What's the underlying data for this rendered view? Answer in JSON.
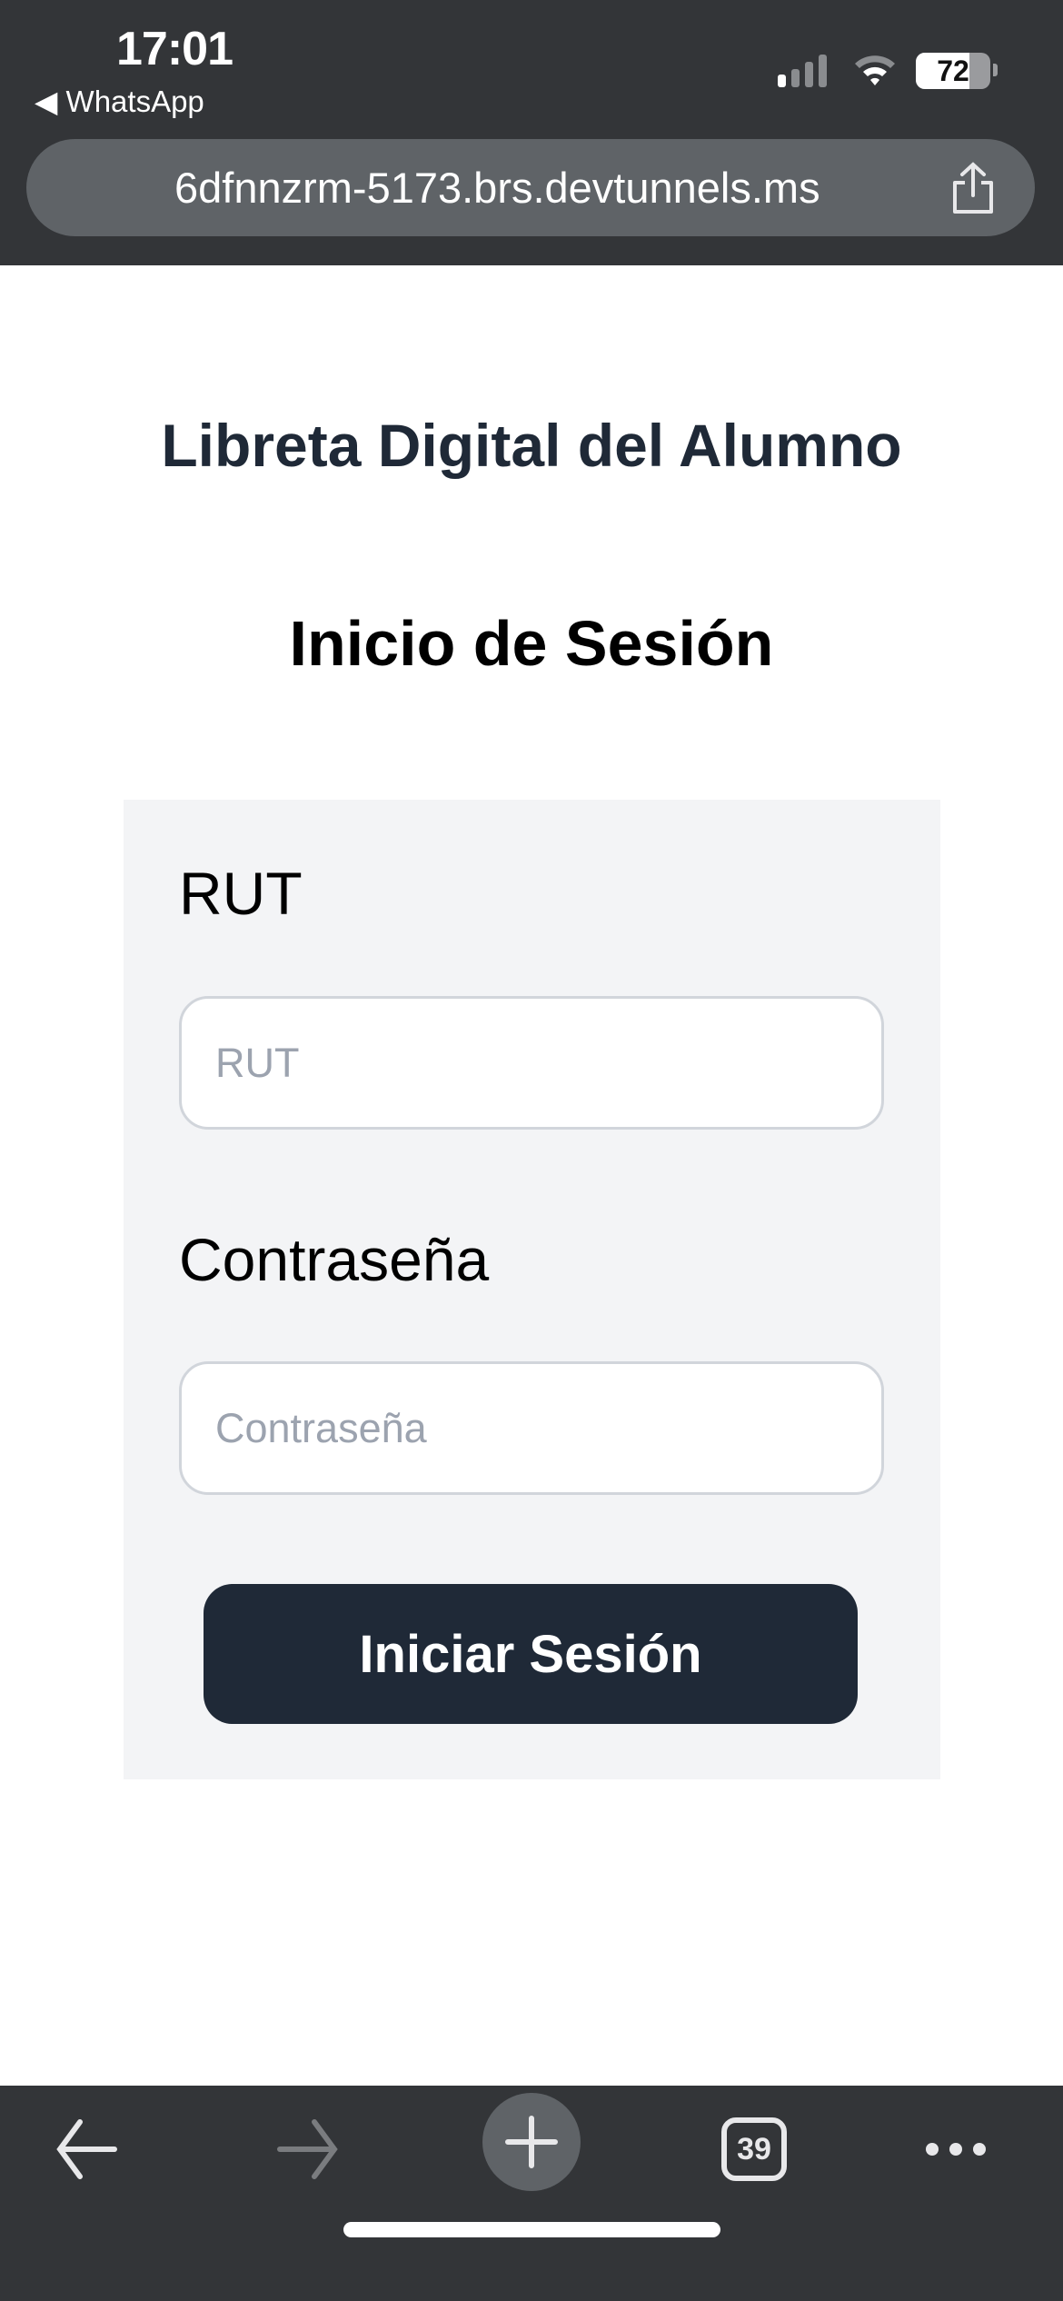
{
  "status_bar": {
    "time": "17:01",
    "back_app": "◀ WhatsApp",
    "battery": "72",
    "battery_level_percent": 72
  },
  "browser": {
    "url": "6dfnnzrm-5173.brs.devtunnels.ms",
    "tab_count": "39"
  },
  "page": {
    "title": "Libreta Digital del Alumno",
    "subtitle": "Inicio de Sesión",
    "form": {
      "rut_label": "RUT",
      "rut_placeholder": "RUT",
      "rut_value": "",
      "password_label": "Contraseña",
      "password_placeholder": "Contraseña",
      "password_value": "",
      "submit_label": "Iniciar Sesión"
    }
  },
  "colors": {
    "primary": "#1f2937",
    "card_bg": "#f3f4f6",
    "browser_chrome": "#333538"
  }
}
